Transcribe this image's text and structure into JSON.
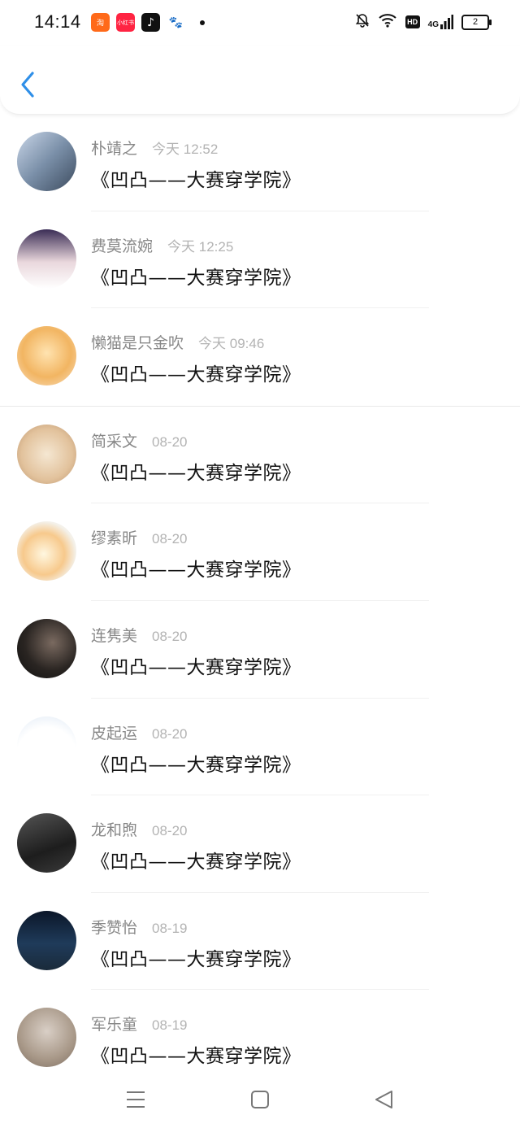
{
  "status_bar": {
    "time": "14:14",
    "app_icons": [
      {
        "name": "app-icon-orange",
        "label": "淘",
        "color": "#ff6a1a"
      },
      {
        "name": "app-icon-red",
        "label": "小红书",
        "color": "#ff2442"
      },
      {
        "name": "app-icon-tiktok",
        "label": "♪",
        "color": "#111111"
      },
      {
        "name": "app-icon-paw",
        "label": "🐾",
        "color": "#ffffff"
      }
    ],
    "network": "4G",
    "hd": "HD",
    "battery": "2"
  },
  "header": {
    "back_icon": "chevron-left-icon",
    "accent": "#2f8fe8"
  },
  "messages": [
    {
      "name": "朴靖之",
      "time": "今天 12:52",
      "text": "《凹凸——大赛穿学院》",
      "avatar_bg": "linear-gradient(135deg,#c9d6e8,#7a8fa8,#3c4b5e)"
    },
    {
      "name": "费莫流婉",
      "time": "今天 12:25",
      "text": "《凹凸——大赛穿学院》",
      "avatar_bg": "linear-gradient(180deg,#3a2c55,#e9d7dc 55%,#ffffff)"
    },
    {
      "name": "懒猫是只金吹",
      "time": "今天 09:46",
      "text": "《凹凸——大赛穿学院》",
      "avatar_bg": "radial-gradient(circle at 50% 45%,#ffe3b0,#f2b562 55%,#f7dfc1)"
    },
    {
      "name": "简采文",
      "time": "08-20",
      "text": "《凹凸——大赛穿学院》",
      "avatar_bg": "radial-gradient(circle at 50% 50%,#f5e7d2,#e2c29c 60%,#b8906a)"
    },
    {
      "name": "缪素昕",
      "time": "08-20",
      "text": "《凹凸——大赛穿学院》",
      "avatar_bg": "radial-gradient(circle at 45% 55%,#fff7e0,#f7c98c 45%,#f4f1ea 70%)"
    },
    {
      "name": "连隽美",
      "time": "08-20",
      "text": "《凹凸——大赛穿学院》",
      "avatar_bg": "radial-gradient(circle at 60% 40%,#7a6a60,#2a2522 55%,#101010)"
    },
    {
      "name": "皮起运",
      "time": "08-20",
      "text": "《凹凸——大赛穿学院》",
      "avatar_bg": "radial-gradient(circle at 50% 70%,#ffffff,#ffffff 60%,#dfe9f5)"
    },
    {
      "name": "龙和煦",
      "time": "08-20",
      "text": "《凹凸——大赛穿学院》",
      "avatar_bg": "linear-gradient(160deg,#555,#1d1d1d 60%,#3b3b3b)"
    },
    {
      "name": "季赞怡",
      "time": "08-19",
      "text": "《凹凸——大赛穿学院》",
      "avatar_bg": "linear-gradient(180deg,#0b1628,#1f3b5a 55%,#1a2a3a)"
    },
    {
      "name": "军乐童",
      "time": "08-19",
      "text": "《凹凸——大赛穿学院》",
      "avatar_bg": "radial-gradient(circle at 50% 40%,#d9cfc6,#a89888 60%,#7d6e62)"
    }
  ],
  "nav_bar": {
    "menu_icon": "menu-icon",
    "home_icon": "home-square-icon",
    "back_icon": "back-triangle-icon"
  }
}
